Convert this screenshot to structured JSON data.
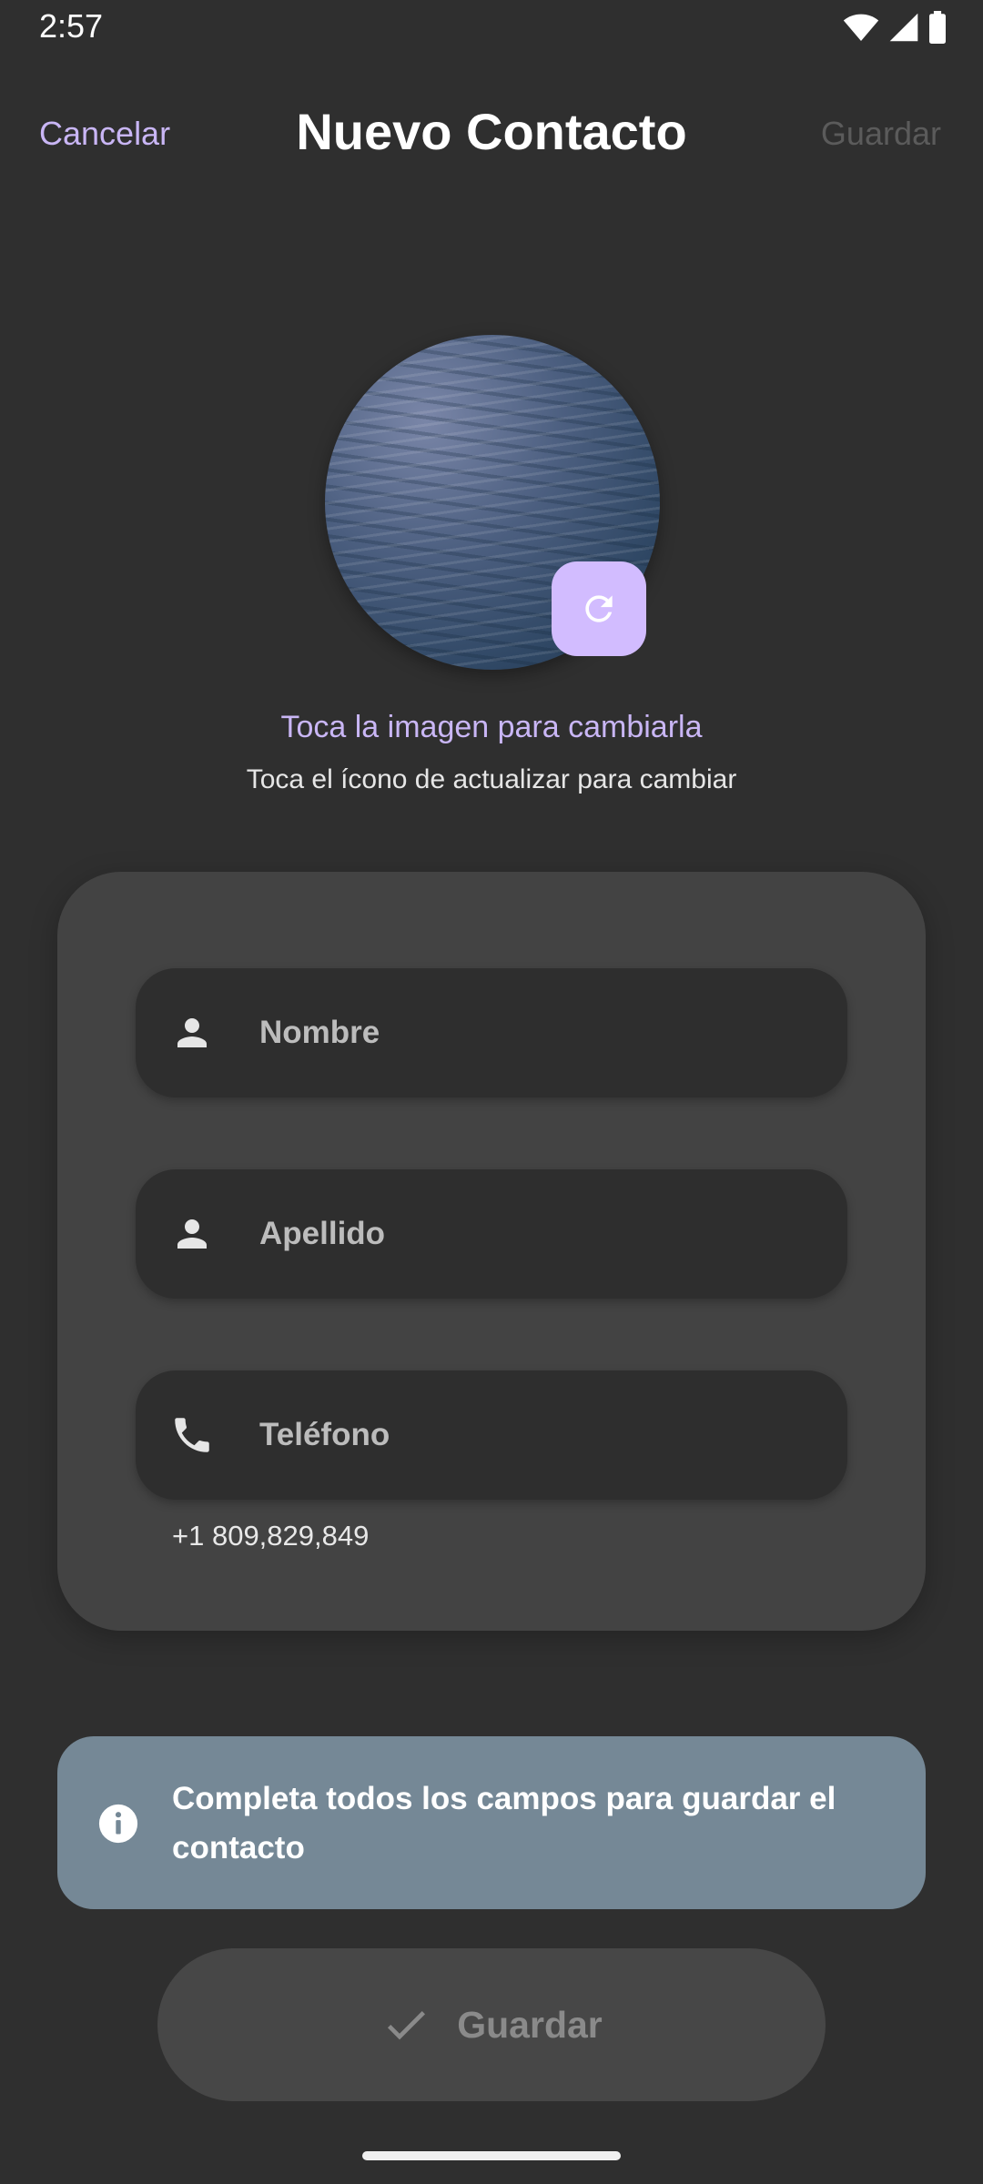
{
  "status_bar": {
    "time": "2:57"
  },
  "top_bar": {
    "cancel_label": "Cancelar",
    "title": "Nuevo Contacto",
    "save_label": "Guardar"
  },
  "avatar": {
    "refresh_icon": "refresh-icon"
  },
  "hints": {
    "primary": "Toca la imagen para cambiarla",
    "secondary": "Toca el ícono de actualizar para cambiar"
  },
  "form": {
    "first_name": {
      "placeholder": "Nombre",
      "value": "",
      "icon": "person-icon"
    },
    "last_name": {
      "placeholder": "Apellido",
      "value": "",
      "icon": "person-icon"
    },
    "phone": {
      "placeholder": "Teléfono",
      "value": "",
      "icon": "phone-icon",
      "helper": "+1 809,829,849"
    }
  },
  "info_banner": {
    "icon": "info-icon",
    "text": "Completa todos los campos para guardar el contacto"
  },
  "save_button": {
    "icon": "check-icon",
    "label": "Guardar"
  },
  "colors": {
    "background": "#2f2f2f",
    "accent": "#c9b6f5",
    "refresh_button": "#d2bcff",
    "card": "#434343",
    "field": "#2e2e2e",
    "banner": "#758896",
    "disabled_text": "#8a8a8a"
  }
}
